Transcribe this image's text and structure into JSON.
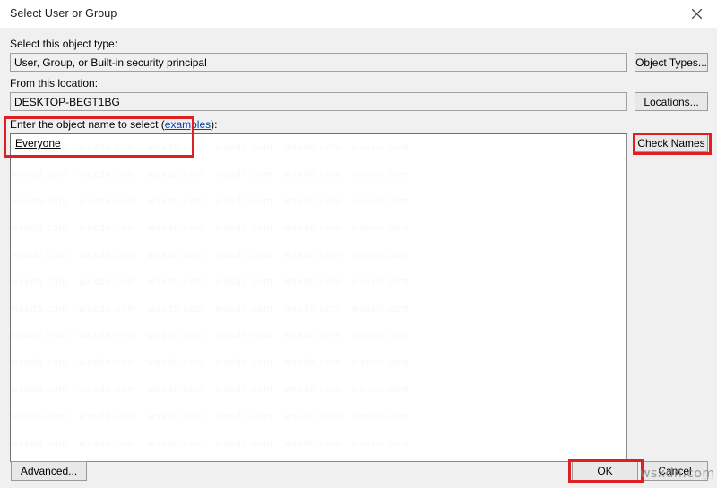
{
  "window": {
    "title": "Select User or Group",
    "close_icon": "close-icon"
  },
  "form": {
    "object_type_label": "Select this object type:",
    "object_type_value": "User, Group, or Built-in security principal",
    "object_types_button": "Object Types...",
    "location_label": "From this location:",
    "location_value": "DESKTOP-BEGT1BG",
    "locations_button": "Locations...",
    "object_name_label_before": "Enter the object name to select (",
    "object_name_link": "examples",
    "object_name_label_after": "):",
    "object_name_value": "Everyone",
    "check_names_button": "Check Names"
  },
  "footer": {
    "advanced_button": "Advanced...",
    "ok_button": "OK",
    "cancel_button": "Cancel"
  },
  "watermark": {
    "text": "wsxdn.com",
    "tiled_text": "wsxdn.com   wsxdn.com   wsxdn.com   wsxdn.com   wsxdn.com   wsxdn.com\nwsxdn.com   wsxdn.com   wsxdn.com   wsxdn.com   wsxdn.com   wsxdn.com\nwsxdn.com   wsxdn.com   wsxdn.com   wsxdn.com   wsxdn.com   wsxdn.com\nwsxdn.com   wsxdn.com   wsxdn.com   wsxdn.com   wsxdn.com   wsxdn.com\nwsxdn.com   wsxdn.com   wsxdn.com   wsxdn.com   wsxdn.com   wsxdn.com\nwsxdn.com   wsxdn.com   wsxdn.com   wsxdn.com   wsxdn.com   wsxdn.com\nwsxdn.com   wsxdn.com   wsxdn.com   wsxdn.com   wsxdn.com   wsxdn.com\nwsxdn.com   wsxdn.com   wsxdn.com   wsxdn.com   wsxdn.com   wsxdn.com\nwsxdn.com   wsxdn.com   wsxdn.com   wsxdn.com   wsxdn.com   wsxdn.com\nwsxdn.com   wsxdn.com   wsxdn.com   wsxdn.com   wsxdn.com   wsxdn.com\nwsxdn.com   wsxdn.com   wsxdn.com   wsxdn.com   wsxdn.com   wsxdn.com\nwsxdn.com   wsxdn.com   wsxdn.com   wsxdn.com   wsxdn.com   wsxdn.com",
    "dots": ":::"
  },
  "annotations": {
    "colors": {
      "highlight": "#e02020"
    }
  }
}
